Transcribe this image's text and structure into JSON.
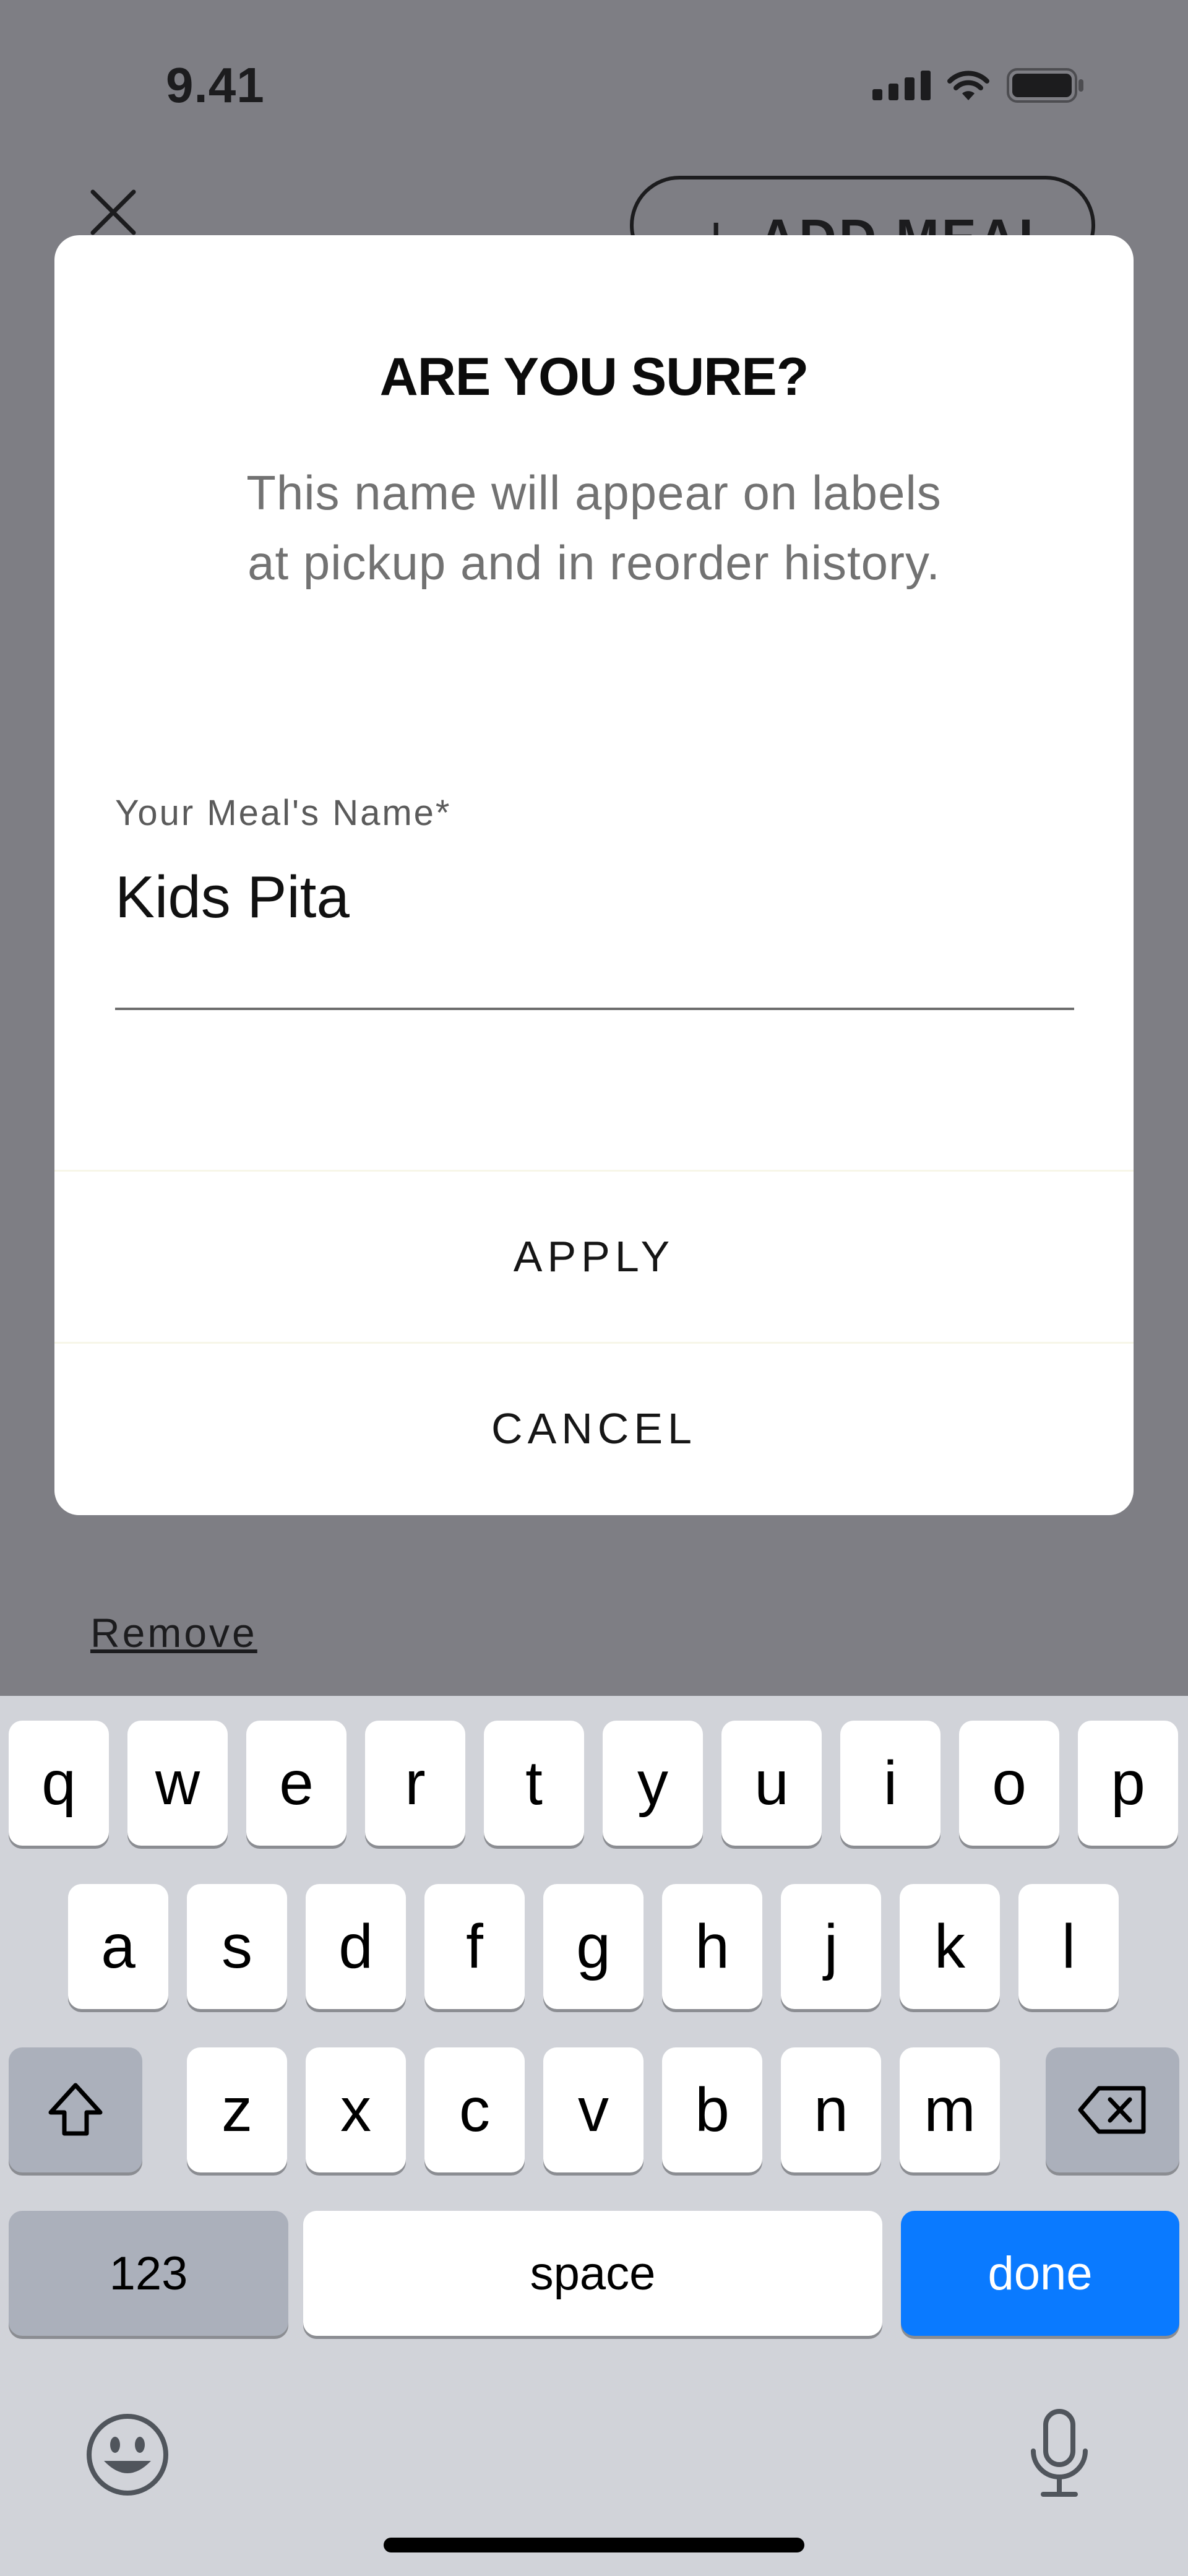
{
  "status_bar": {
    "time": "9.41"
  },
  "header": {
    "add_meal_label": "ADD MEAL"
  },
  "dialog": {
    "title": "ARE YOU SURE?",
    "message": "This name will appear on labels at pickup and in reorder history.",
    "field_label": "Your Meal's Name*",
    "field_value": "Kids Pita",
    "apply_label": "APPLY",
    "cancel_label": "CANCEL"
  },
  "page": {
    "remove_label": "Remove"
  },
  "keyboard": {
    "row1": [
      "q",
      "w",
      "e",
      "r",
      "t",
      "y",
      "u",
      "i",
      "o",
      "p"
    ],
    "row2": [
      "a",
      "s",
      "d",
      "f",
      "g",
      "h",
      "j",
      "k",
      "l"
    ],
    "row3": [
      "z",
      "x",
      "c",
      "v",
      "b",
      "n",
      "m"
    ],
    "numbers_label": "123",
    "space_label": "space",
    "done_label": "done"
  },
  "colors": {
    "accent_blue": "#0a7aff",
    "overlay": "#7e7e84",
    "keyboard_bg": "#d1d3d9"
  },
  "icons": [
    "close-icon",
    "plus-icon",
    "signal-icon",
    "wifi-icon",
    "battery-icon",
    "shift-icon",
    "backspace-icon",
    "emoji-icon",
    "microphone-icon"
  ]
}
